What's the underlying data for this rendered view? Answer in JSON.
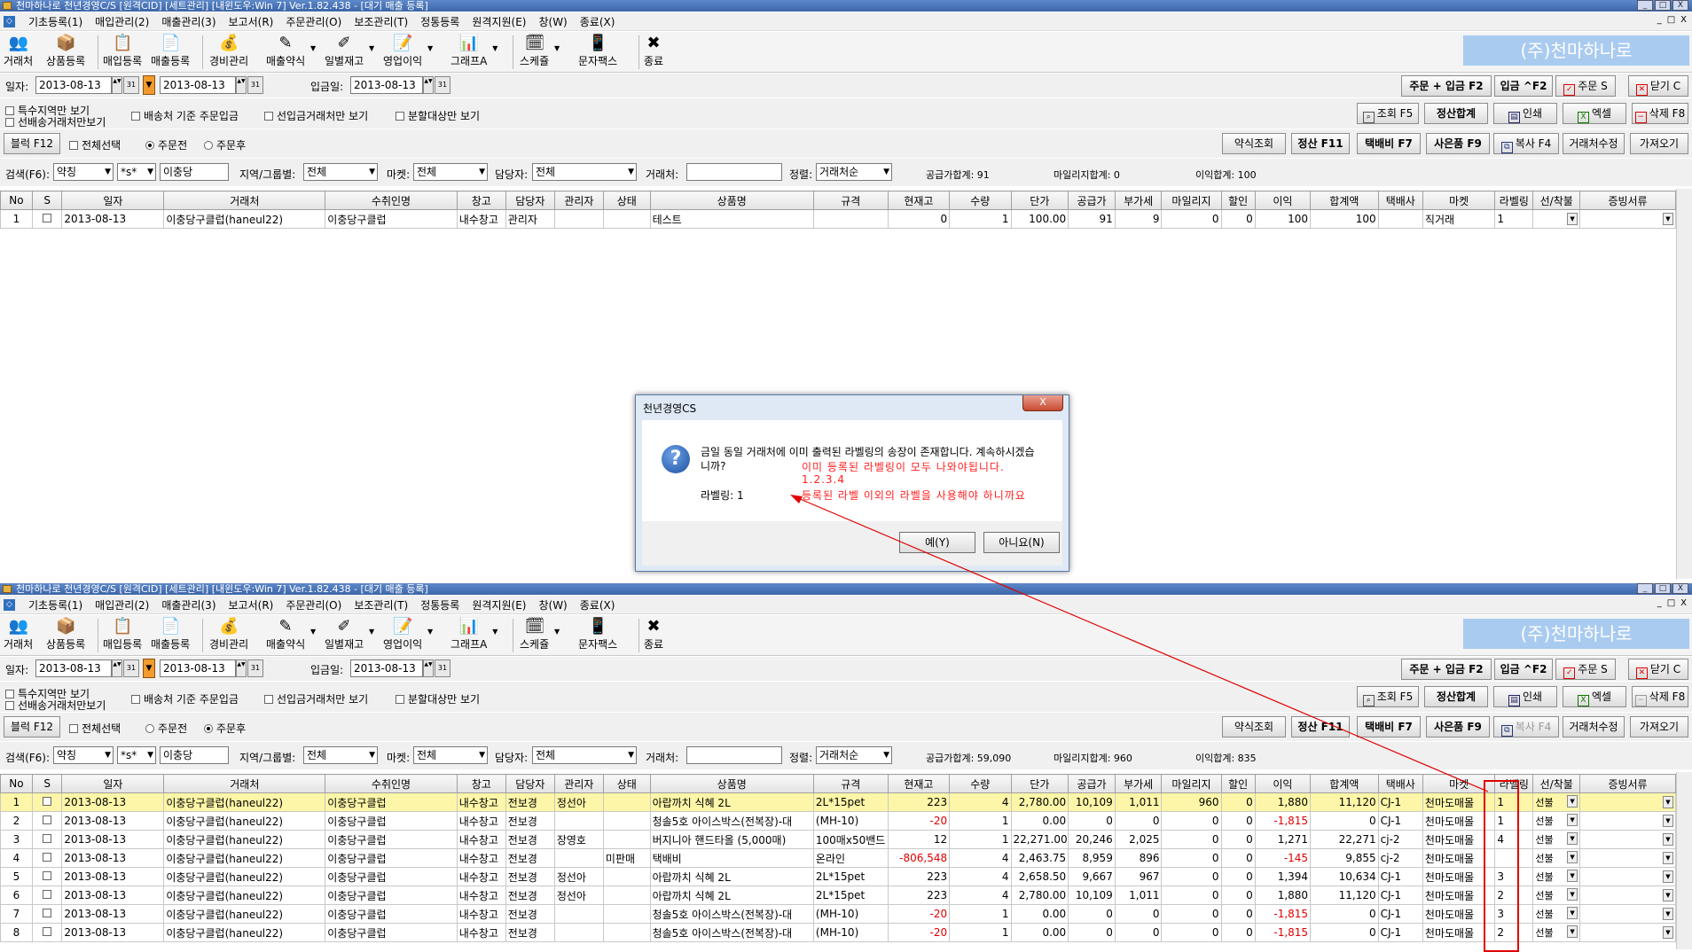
{
  "window_title": "천마하나로 천년경영C/S [원격CID] [세트관리] [내윈도우:Win 7] Ver.1.82.438 - [대기 매출 등록]",
  "window_buttons": [
    "_",
    "□",
    "X"
  ],
  "menu": [
    "기초등록(1)",
    "매입관리(2)",
    "매출관리(3)",
    "보고서(R)",
    "주문관리(O)",
    "보조관리(T)",
    "정통등록",
    "원격지원(E)",
    "창(W)",
    "종료(X)"
  ],
  "toolbar": [
    {
      "label": "거래처",
      "icon": "people-icon",
      "glyph": "👥"
    },
    {
      "label": "상품등록",
      "icon": "box-icon",
      "glyph": "📦"
    },
    {
      "label": "매입등록",
      "icon": "purchase-doc-icon",
      "glyph": "📋"
    },
    {
      "label": "매출등록",
      "icon": "sales-doc-icon",
      "glyph": "📄"
    },
    {
      "label": "경비관리",
      "icon": "coins-icon",
      "glyph": "💰"
    },
    {
      "label": "매출약식",
      "icon": "pen-icon",
      "glyph": "✎"
    },
    {
      "label": "일별재고",
      "icon": "inventory-icon",
      "glyph": "✐"
    },
    {
      "label": "영업이익",
      "icon": "profit-icon",
      "glyph": "📝"
    },
    {
      "label": "그래프A",
      "icon": "bar-chart-icon",
      "glyph": "📊"
    },
    {
      "label": "스케쥴",
      "icon": "calendar-icon",
      "glyph": "🗓"
    },
    {
      "label": "문자팩스",
      "icon": "phone-icon",
      "glyph": "📱"
    },
    {
      "label": "종료",
      "icon": "close-x-icon",
      "glyph": "✖"
    }
  ],
  "brand": "(주)천마하나로",
  "date_row": {
    "date_label": "일자:",
    "date_from": "2013-08-13",
    "date_to": "2013-08-13",
    "cal_glyph": "31",
    "arrow_glyph": "▼",
    "entry_label": "입금일:",
    "entry_date": "2013-08-13",
    "btn_order_deposit": "주문 + 입금 F2",
    "btn_deposit": "입금 ^F2",
    "btn_order": "주문 S",
    "btn_close": "닫기 C"
  },
  "filter_row": {
    "chk_special": "특수지역만 보기",
    "chk_prepaid": "선배송거래처만보기",
    "chk_shipping": "배송처 기준 주문입금",
    "chk_deposit": "선입금거래처만 보기",
    "chk_split": "분할대상만 보기",
    "btn_view": "조회 F5",
    "btn_settle": "정산합계",
    "btn_print": "인쇄",
    "btn_excel": "엑셀",
    "btn_delete": "삭제 F8"
  },
  "block_row": {
    "btn_block": "블럭 F12",
    "chk_all": "전체선택",
    "radio_before": "주문전",
    "radio_after": "주문후",
    "btn_simple": "약식조회",
    "btn_calc": "정산 F11",
    "btn_courier": "택배비 F7",
    "btn_gift": "사은품 F9",
    "btn_copy": "복사 F4",
    "btn_edit_cust": "거래처수정",
    "btn_fetch": "가져오기"
  },
  "search_row": {
    "search_label": "검색(F6):",
    "search_field": "약칭",
    "search_op": "*s*",
    "search_value": "이충당",
    "region_label": "지역/그룹별:",
    "region_value": "전체",
    "market_label": "마켓:",
    "market_value": "전체",
    "manager_label": "담당자:",
    "manager_value": "전체",
    "customer_label": "거래처:",
    "customer_value": "",
    "sort_label": "정렬:",
    "sort_value": "거래처순"
  },
  "columns": [
    "No",
    "S",
    "일자",
    "거래처",
    "수취인명",
    "창고",
    "담당자",
    "관리자",
    "상태",
    "상품명",
    "규격",
    "현재고",
    "수량",
    "단가",
    "공급가",
    "부가세",
    "마일리지",
    "할인",
    "이익",
    "합계액",
    "택배사",
    "마켓",
    "라벨링",
    "선/착불",
    "증빙서류"
  ],
  "win1": {
    "totals": {
      "supply": "공급가합계: 91",
      "mileage": "마일리지합계: 0",
      "profit": "이익합계: 100"
    },
    "rows": [
      [
        "1",
        "",
        "2013-08-13",
        "이충당구클럽(haneul22)",
        "이충당구클럽",
        "내수창고",
        "관리자",
        "",
        "",
        "테스트",
        "",
        "0",
        "1",
        "100.00",
        "91",
        "9",
        "0",
        "0",
        "100",
        "100",
        "",
        "직거래",
        "1",
        "",
        ""
      ]
    ]
  },
  "win2": {
    "totals": {
      "supply": "공급가합계: 59,090",
      "mileage": "마일리지합계: 960",
      "profit": "이익합계: 835"
    },
    "rows": [
      [
        "1",
        "",
        "2013-08-13",
        "이충당구클럽(haneul22)",
        "이충당구클럽",
        "내수창고",
        "전보경",
        "정선아",
        "",
        "아랍까치 식혜 2L",
        "2L*15pet",
        "223",
        "4",
        "2,780.00",
        "10,109",
        "1,011",
        "960",
        "0",
        "1,880",
        "11,120",
        "CJ-1",
        "천마도매몰",
        "1",
        "선불",
        ""
      ],
      [
        "2",
        "",
        "2013-08-13",
        "이충당구클럽(haneul22)",
        "이충당구클럽",
        "내수창고",
        "전보경",
        "",
        "",
        "청솔5호 아이스박스(전복장)-대",
        "(MH-10)",
        "-20",
        "1",
        "0.00",
        "0",
        "0",
        "0",
        "0",
        "-1,815",
        "0",
        "CJ-1",
        "천마도매몰",
        "1",
        "선불",
        ""
      ],
      [
        "3",
        "",
        "2013-08-13",
        "이충당구클럽(haneul22)",
        "이충당구클럽",
        "내수창고",
        "전보경",
        "장영호",
        "",
        "버지니아 핸드타올 (5,000매)",
        "100매x50밴드",
        "12",
        "1",
        "22,271.00",
        "20,246",
        "2,025",
        "0",
        "0",
        "1,271",
        "22,271",
        "cj-2",
        "천마도매몰",
        "4",
        "선불",
        ""
      ],
      [
        "4",
        "",
        "2013-08-13",
        "이충당구클럽(haneul22)",
        "이충당구클럽",
        "내수창고",
        "전보경",
        "",
        "미판매",
        "택배비",
        "온라인",
        "-806,548",
        "4",
        "2,463.75",
        "8,959",
        "896",
        "0",
        "0",
        "-145",
        "9,855",
        "cj-2",
        "천마도매몰",
        "",
        "선불",
        ""
      ],
      [
        "5",
        "",
        "2013-08-13",
        "이충당구클럽(haneul22)",
        "이충당구클럽",
        "내수창고",
        "전보경",
        "정선아",
        "",
        "아랍까치 식혜 2L",
        "2L*15pet",
        "223",
        "4",
        "2,658.50",
        "9,667",
        "967",
        "0",
        "0",
        "1,394",
        "10,634",
        "CJ-1",
        "천마도매몰",
        "3",
        "선불",
        ""
      ],
      [
        "6",
        "",
        "2013-08-13",
        "이충당구클럽(haneul22)",
        "이충당구클럽",
        "내수창고",
        "전보경",
        "정선아",
        "",
        "아랍까치 식혜 2L",
        "2L*15pet",
        "223",
        "4",
        "2,780.00",
        "10,109",
        "1,011",
        "0",
        "0",
        "1,880",
        "11,120",
        "CJ-1",
        "천마도매몰",
        "2",
        "선불",
        ""
      ],
      [
        "7",
        "",
        "2013-08-13",
        "이충당구클럽(haneul22)",
        "이충당구클럽",
        "내수창고",
        "전보경",
        "",
        "",
        "청솔5호 아이스박스(전복장)-대",
        "(MH-10)",
        "-20",
        "1",
        "0.00",
        "0",
        "0",
        "0",
        "0",
        "-1,815",
        "0",
        "CJ-1",
        "천마도매몰",
        "3",
        "선불",
        ""
      ],
      [
        "8",
        "",
        "2013-08-13",
        "이충당구클럽(haneul22)",
        "이충당구클럽",
        "내수창고",
        "전보경",
        "",
        "",
        "청솔5호 아이스박스(전복장)-대",
        "(MH-10)",
        "-20",
        "1",
        "0.00",
        "0",
        "0",
        "0",
        "0",
        "-1,815",
        "0",
        "CJ-1",
        "천마도매몰",
        "2",
        "선불",
        ""
      ]
    ]
  },
  "dialog": {
    "title": "천년경영CS",
    "close": "X",
    "message": "금일 동일 거래처에 이미 출력된 라벨링의 송장이 존재합니다. 계속하시겠습니까?",
    "labeling": "라벨링: 1",
    "annotation_1": "이미 등록된 라벨링이 모두 나와야됩니다.",
    "annotation_2": "1.2.3.4",
    "annotation_3": "등록된 라벨 이외의 라벨을 사용해야 하니까요",
    "btn_yes": "예(Y)",
    "btn_no": "아니요(N)"
  },
  "colors": {
    "annotation": "#ff2020",
    "brand_bg": "#aacbf0",
    "highlight_row": "#fdf6a8",
    "negative": "#e00000"
  }
}
